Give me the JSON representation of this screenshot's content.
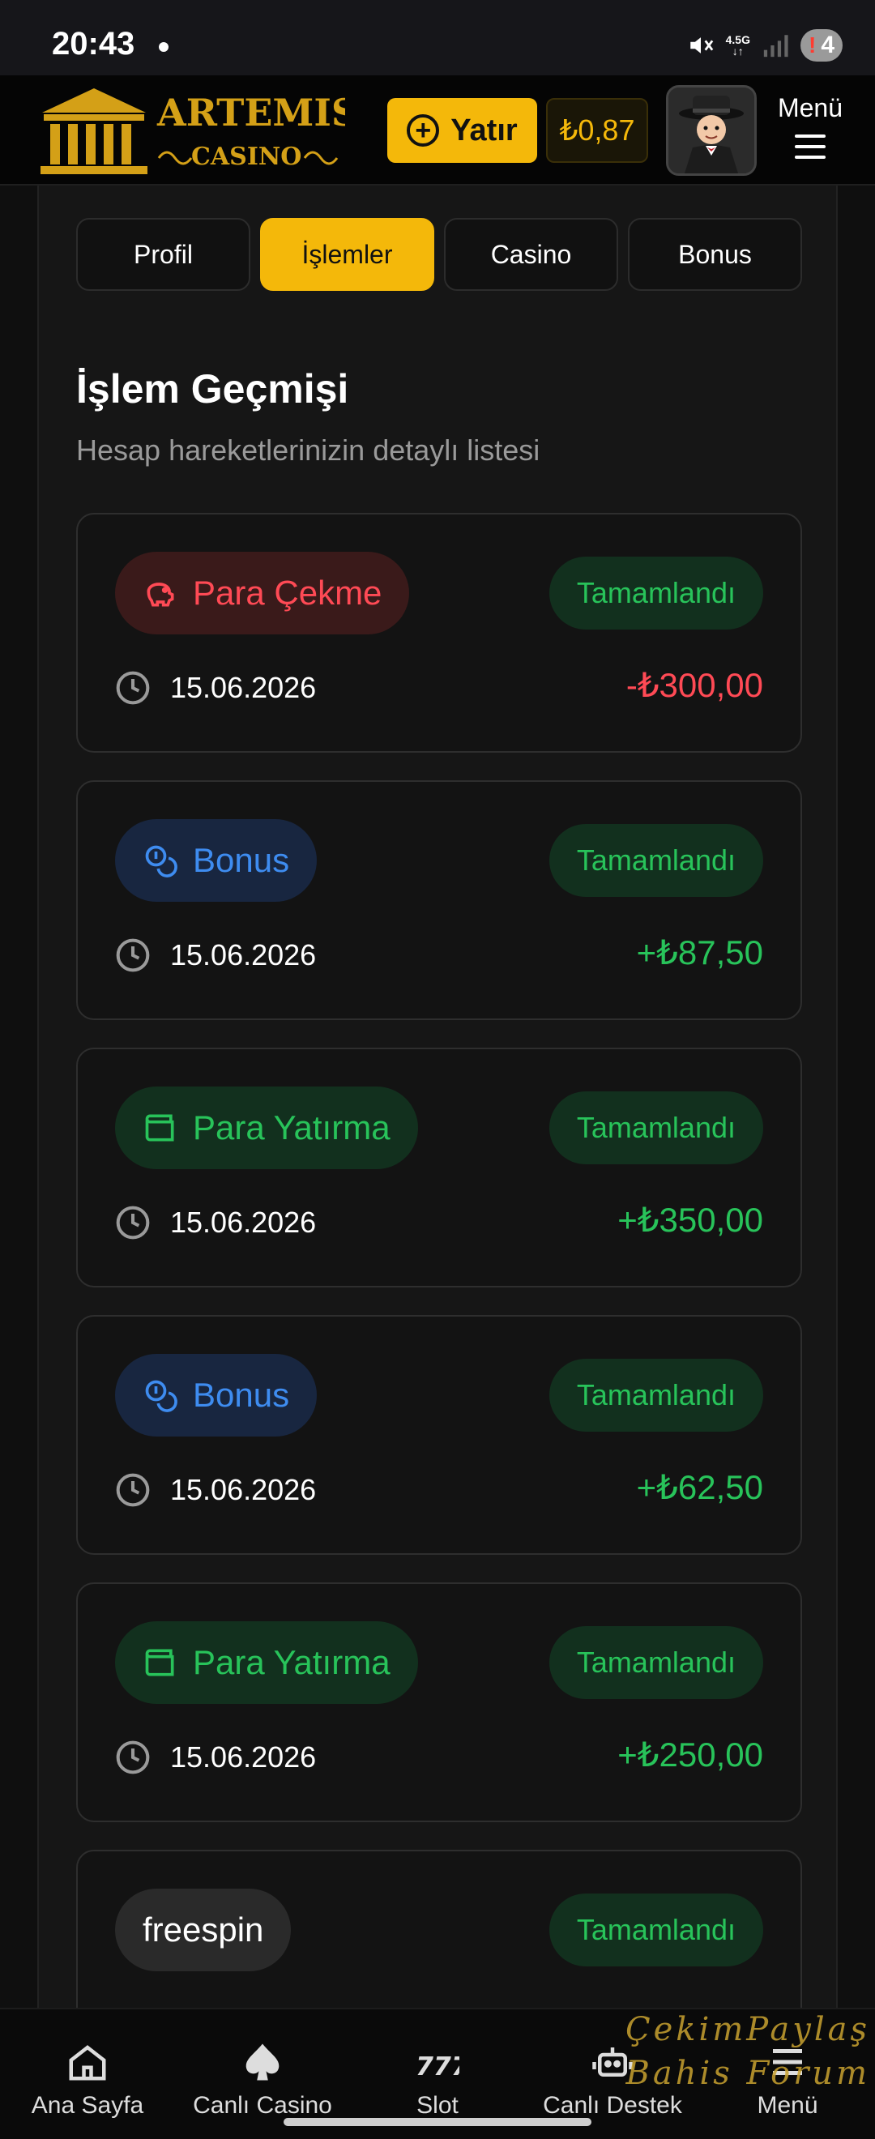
{
  "status_bar": {
    "time": "20:43",
    "network": "4.5G",
    "battery": "4"
  },
  "header": {
    "logo_top": "ARTEMIS",
    "logo_bottom": "CASINO",
    "deposit_label": "Yatır",
    "balance": "₺0,87",
    "menu_label": "Menü"
  },
  "tabs": [
    "Profil",
    "İşlemler",
    "Casino",
    "Bonus"
  ],
  "active_tab": "İşlemler",
  "page": {
    "title": "İşlem Geçmişi",
    "subtitle": "Hesap hareketlerinizin detaylı listesi"
  },
  "transactions": [
    {
      "type": "Para Çekme",
      "status": "Tamamlandı",
      "date": "15.06.2026",
      "amount": "-₺300,00",
      "kind": "withdraw"
    },
    {
      "type": "Bonus",
      "status": "Tamamlandı",
      "date": "15.06.2026",
      "amount": "+₺87,50",
      "kind": "bonus"
    },
    {
      "type": "Para Yatırma",
      "status": "Tamamlandı",
      "date": "15.06.2026",
      "amount": "+₺350,00",
      "kind": "deposit"
    },
    {
      "type": "Bonus",
      "status": "Tamamlandı",
      "date": "15.06.2026",
      "amount": "+₺62,50",
      "kind": "bonus"
    },
    {
      "type": "Para Yatırma",
      "status": "Tamamlandı",
      "date": "15.06.2026",
      "amount": "+₺250,00",
      "kind": "deposit"
    },
    {
      "type": "freespin",
      "status": "Tamamlandı",
      "date": "",
      "amount": "",
      "kind": "freespin"
    }
  ],
  "bottom_nav": [
    {
      "label": "Ana Sayfa",
      "icon": "home-icon"
    },
    {
      "label": "Canlı Casino",
      "icon": "spade-icon"
    },
    {
      "label": "Slot",
      "icon": "slot-777-icon"
    },
    {
      "label": "Canlı Destek",
      "icon": "support-bot-icon"
    },
    {
      "label": "Menü",
      "icon": "menu-icon"
    }
  ],
  "watermark": [
    "ÇekimPaylaş",
    "Bahis Forum"
  ],
  "colors": {
    "accent": "#f4b80a",
    "success": "#28c35a",
    "danger": "#ff4a55",
    "bonus": "#3e8cf0"
  }
}
